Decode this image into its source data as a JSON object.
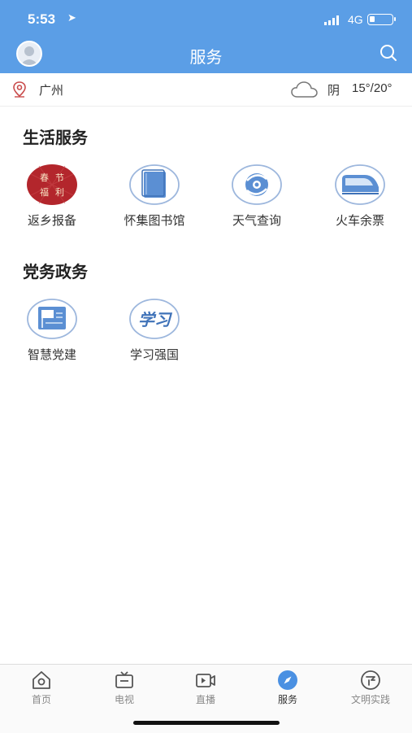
{
  "status": {
    "time": "5:53",
    "network": "4G",
    "battery_level": 0.25
  },
  "navbar": {
    "title": "服务"
  },
  "location": {
    "city": "广州",
    "weather": "阴",
    "temp": "15°/20°"
  },
  "sections": [
    {
      "title": "生活服务",
      "items": [
        {
          "label": "返乡报备",
          "icon": "spring-festival-icon",
          "icon_chars": [
            "春",
            "节",
            "福",
            "利"
          ]
        },
        {
          "label": "怀集图书馆",
          "icon": "library-book-icon"
        },
        {
          "label": "天气查询",
          "icon": "weather-swirl-icon"
        },
        {
          "label": "火车余票",
          "icon": "train-icon"
        }
      ]
    },
    {
      "title": "党务政务",
      "items": [
        {
          "label": "智慧党建",
          "icon": "party-flag-icon"
        },
        {
          "label": "学习强国",
          "icon": "xuexi-calligraphy-icon",
          "icon_chars": "学习"
        }
      ]
    }
  ],
  "tabs": [
    {
      "label": "首页",
      "icon": "home-icon"
    },
    {
      "label": "电视",
      "icon": "tv-icon"
    },
    {
      "label": "直播",
      "icon": "live-video-icon"
    },
    {
      "label": "服务",
      "icon": "compass-icon",
      "active": true
    },
    {
      "label": "文明实践",
      "icon": "practice-icon"
    }
  ],
  "colors": {
    "brand": "#5b9ee6",
    "icon_ring": "#9db7dd",
    "icon_fill": "#5b8fd3",
    "festival_red": "#b3262c"
  }
}
